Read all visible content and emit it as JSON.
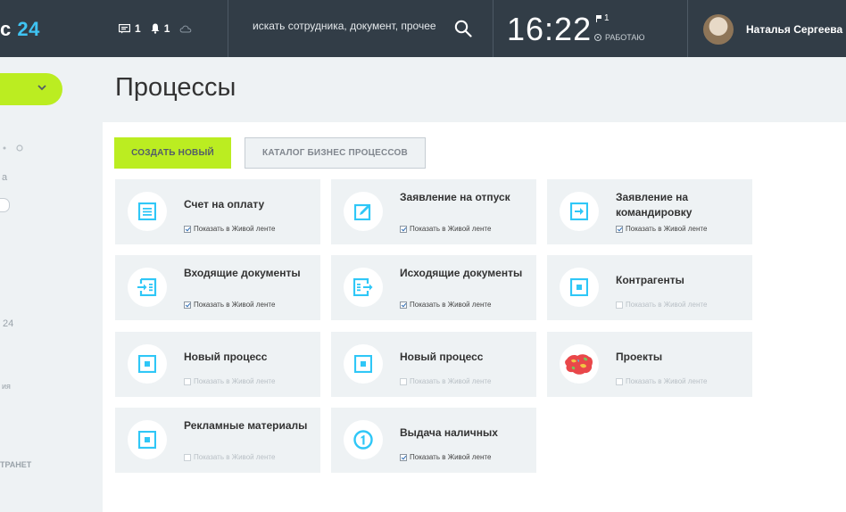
{
  "header": {
    "logo_fragment": "24",
    "chat_count": "1",
    "notification_count": "1",
    "search_placeholder": "искать сотрудника, документ, прочее",
    "clock": "16:22",
    "flag_count": "1",
    "work_status": "РАБОТАЮ",
    "user_name": "Наталья Сергеева"
  },
  "sidebar": {
    "fragments": [
      "а",
      "24",
      "ия",
      "ТРАНЕТ"
    ]
  },
  "page": {
    "title": "Процессы",
    "create_button": "СОЗДАТЬ НОВЫЙ",
    "catalog_button": "КАТАЛОГ БИЗНЕС ПРОЦЕССОВ"
  },
  "feed_label": "Показать в Живой ленте",
  "cards": [
    {
      "name": "Счет на оплату",
      "icon": "invoice-icon",
      "feed": true
    },
    {
      "name": "Заявление на отпуск",
      "icon": "edit-icon",
      "feed": true
    },
    {
      "name": "Заявление на командировку",
      "icon": "arrow-in-icon",
      "feed": true
    },
    {
      "name": "Входящие документы",
      "icon": "incoming-docs-icon",
      "feed": true
    },
    {
      "name": "Исходящие документы",
      "icon": "outgoing-docs-icon",
      "feed": true
    },
    {
      "name": "Контрагенты",
      "icon": "square-icon",
      "feed": false
    },
    {
      "name": "Новый процесс",
      "icon": "square-icon",
      "feed": false
    },
    {
      "name": "Новый процесс",
      "icon": "square-icon",
      "feed": false
    },
    {
      "name": "Проекты",
      "icon": "map-image-icon",
      "feed": false
    },
    {
      "name": "Рекламные материалы",
      "icon": "square-icon",
      "feed": false
    },
    {
      "name": "Выдача наличных",
      "icon": "cash-icon",
      "feed": true
    }
  ],
  "colors": {
    "topbar": "#323d47",
    "accent_green": "#bbed21",
    "icon_blue": "#2fc7f7",
    "card_bg": "#eef2f4"
  }
}
